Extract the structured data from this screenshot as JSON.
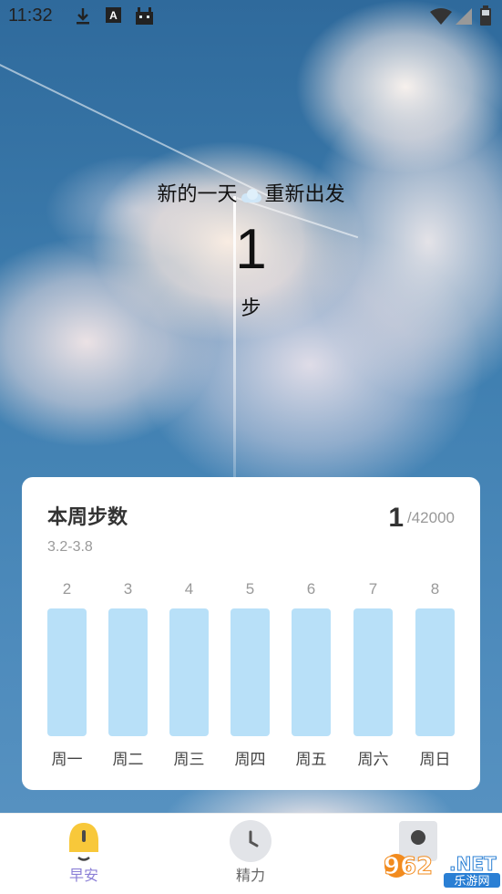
{
  "status_bar": {
    "time": "11:32",
    "left_icons": [
      "download-icon",
      "font-a-icon",
      "android-icon"
    ],
    "right_icons": [
      "wifi-icon",
      "signal-icon",
      "battery-icon"
    ]
  },
  "hero": {
    "message_left": "新的一天",
    "message_right": "重新出发",
    "emoji": "cloud-icon",
    "step_count": "1",
    "step_unit": "步"
  },
  "weekly_card": {
    "title": "本周步数",
    "date_range": "3.2-3.8",
    "current": "1",
    "goal": "/42000",
    "days": [
      {
        "date": "2",
        "label": "周一"
      },
      {
        "date": "3",
        "label": "周二"
      },
      {
        "date": "4",
        "label": "周三"
      },
      {
        "date": "5",
        "label": "周四"
      },
      {
        "date": "6",
        "label": "周五"
      },
      {
        "date": "7",
        "label": "周六"
      },
      {
        "date": "8",
        "label": "周日"
      }
    ],
    "bar_color": "#b8e0f8"
  },
  "bottom_nav": {
    "items": [
      {
        "label": "早安",
        "icon": "bell-icon",
        "active": true
      },
      {
        "label": "精力",
        "icon": "clock-icon",
        "active": false
      },
      {
        "label": "",
        "icon": "profile-icon",
        "active": false
      }
    ],
    "active_color": "#8b7fd6"
  },
  "watermark": {
    "text_top": "962",
    "text_net": ".NET",
    "text_bottom": "乐游网"
  }
}
